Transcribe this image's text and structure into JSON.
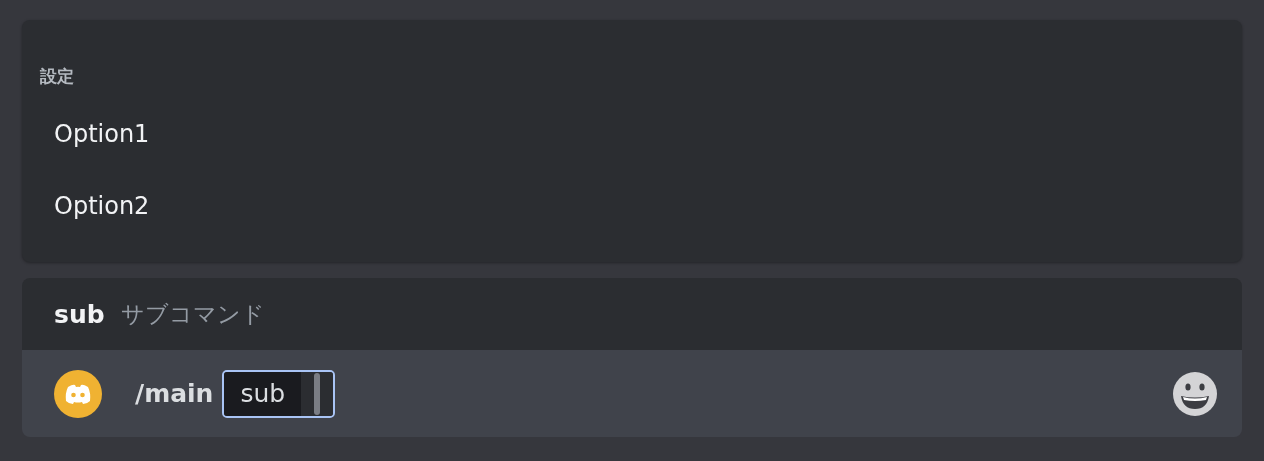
{
  "popup": {
    "title": "設定",
    "options": [
      {
        "label": "Option1",
        "selected": false
      },
      {
        "label": "Option2",
        "selected": false
      }
    ]
  },
  "suggestion": {
    "command": "sub",
    "description": "サブコマンド"
  },
  "input": {
    "command": "/main",
    "option_value": "sub"
  }
}
